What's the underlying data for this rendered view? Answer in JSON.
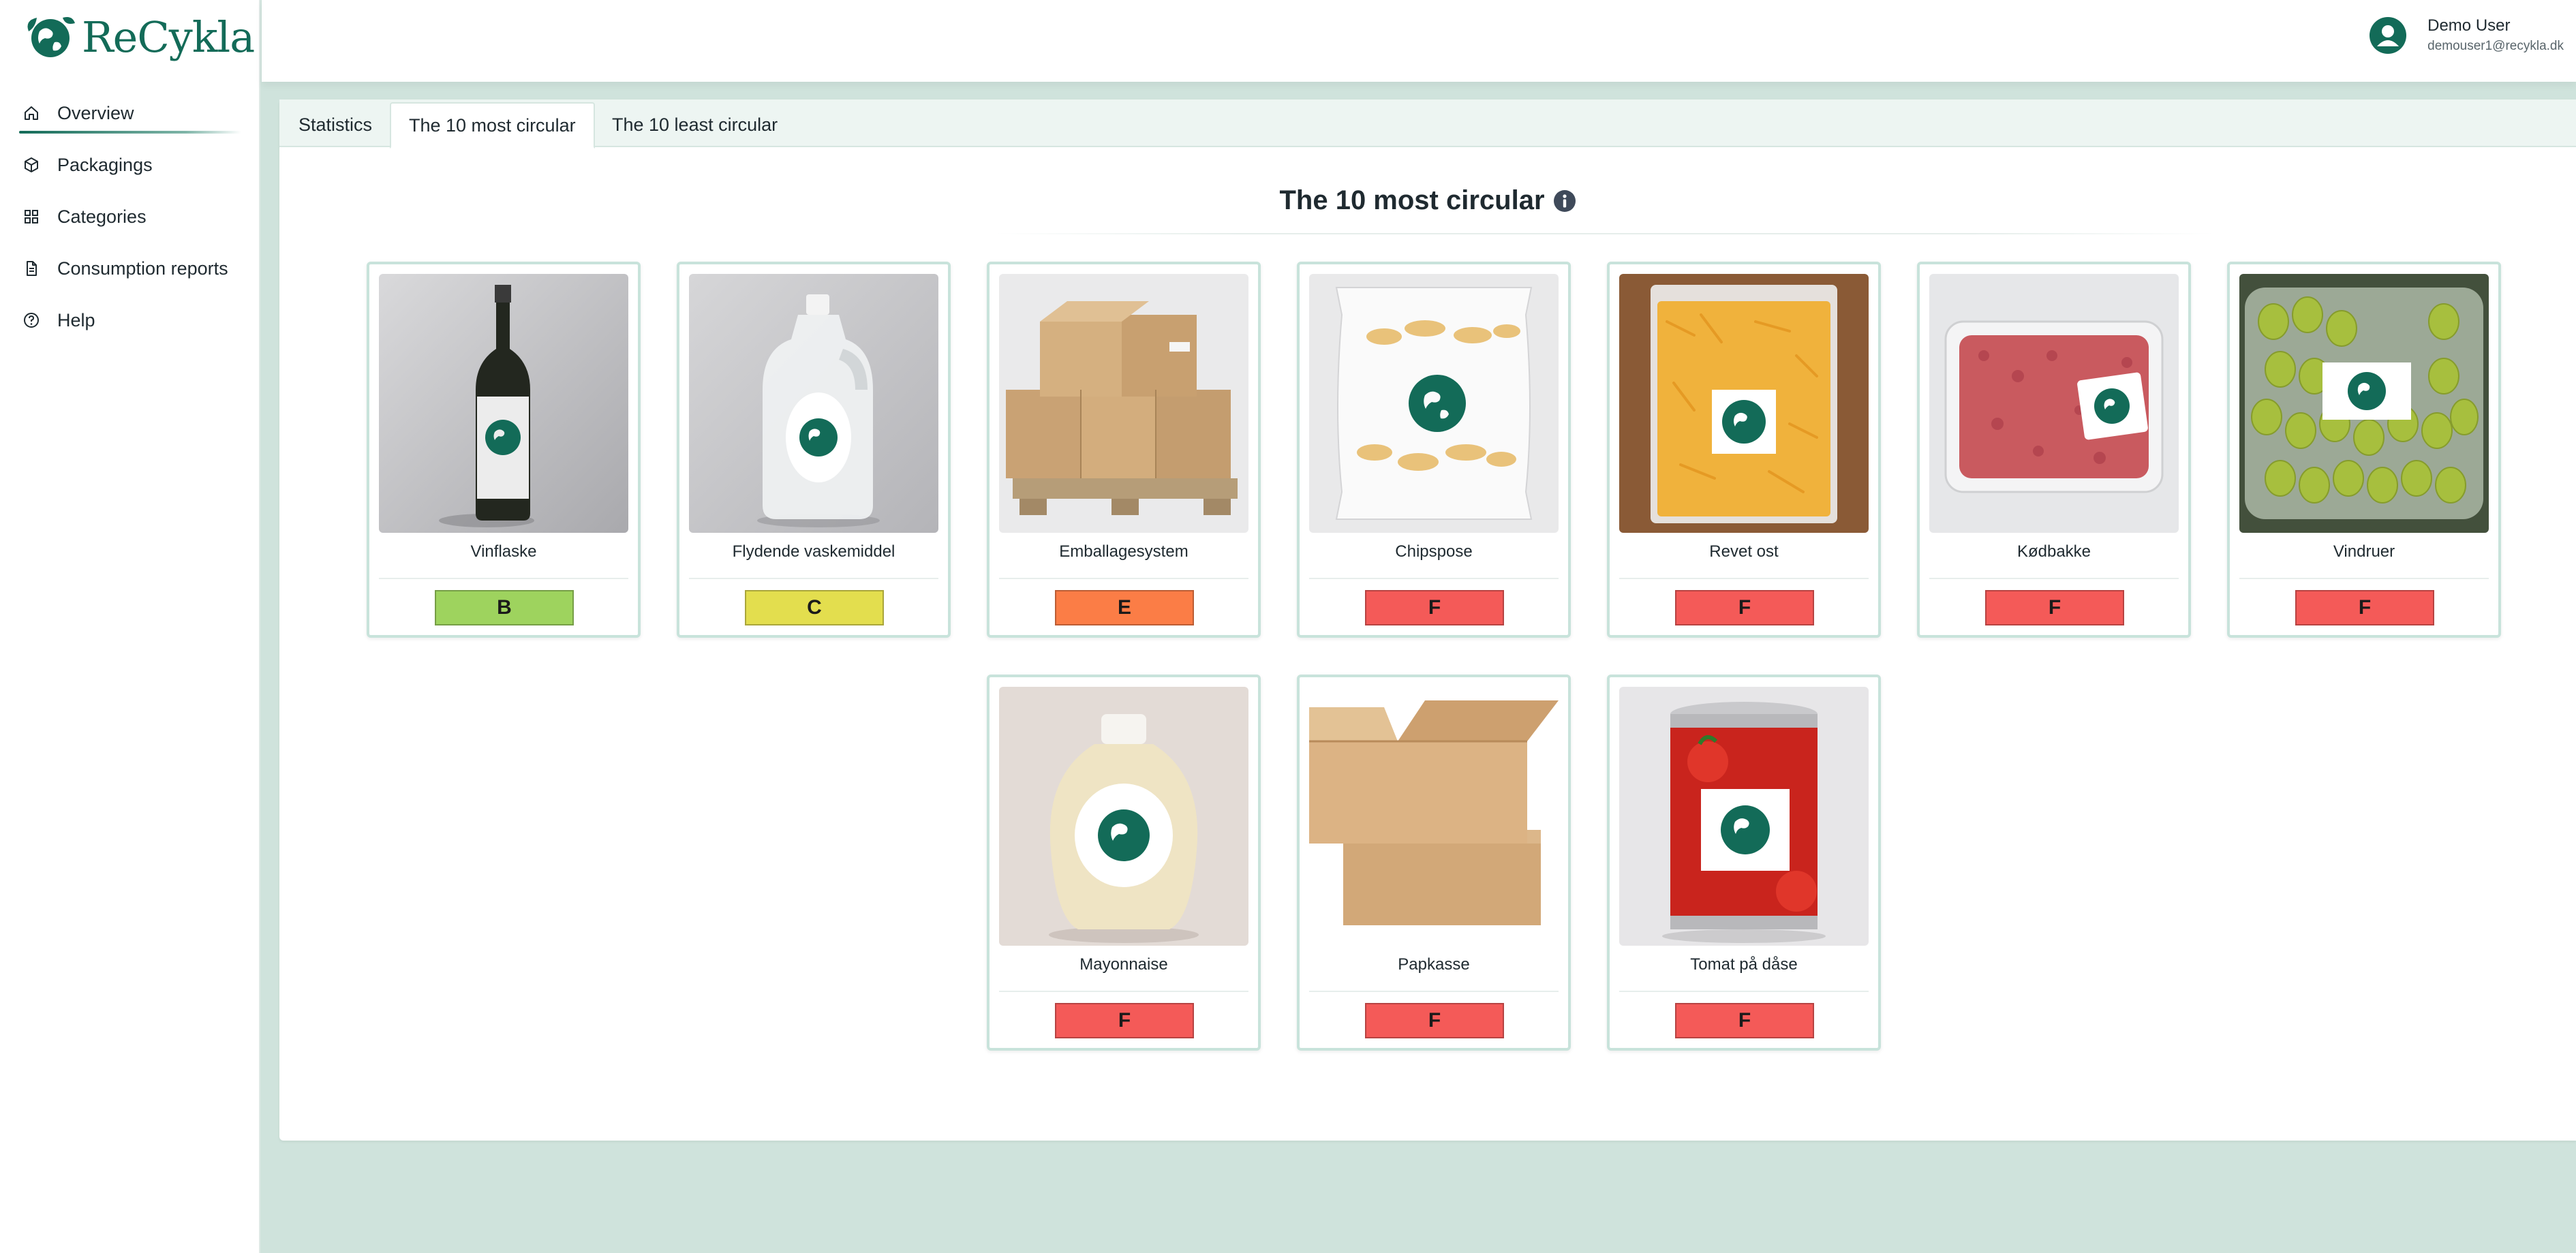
{
  "app": {
    "name": "ReCykla"
  },
  "sidebar": {
    "items": [
      {
        "label": "Overview",
        "icon": "home-icon",
        "active": true
      },
      {
        "label": "Packagings",
        "icon": "box-icon",
        "active": false
      },
      {
        "label": "Categories",
        "icon": "grid-icon",
        "active": false
      },
      {
        "label": "Consumption reports",
        "icon": "document-icon",
        "active": false
      },
      {
        "label": "Help",
        "icon": "help-icon",
        "active": false
      }
    ]
  },
  "header": {
    "user": {
      "name": "Demo User",
      "email": "demouser1@recykla.dk"
    }
  },
  "tabs": [
    {
      "label": "Statistics",
      "active": false
    },
    {
      "label": "The 10 most circular",
      "active": true
    },
    {
      "label": "The 10 least circular",
      "active": false
    }
  ],
  "main": {
    "title": "The 10 most circular",
    "products": [
      {
        "name": "Vinflaske",
        "grade": "B",
        "image": "wine-bottle"
      },
      {
        "name": "Flydende vaskemiddel",
        "grade": "C",
        "image": "detergent-bottle"
      },
      {
        "name": "Emballagesystem",
        "grade": "E",
        "image": "pallet-boxes"
      },
      {
        "name": "Chipspose",
        "grade": "F",
        "image": "chips-bag"
      },
      {
        "name": "Revet ost",
        "grade": "F",
        "image": "grated-cheese"
      },
      {
        "name": "Kødbakke",
        "grade": "F",
        "image": "meat-tray"
      },
      {
        "name": "Vindruer",
        "grade": "F",
        "image": "grapes"
      },
      {
        "name": "Mayonnaise",
        "grade": "F",
        "image": "mayonnaise-bottle"
      },
      {
        "name": "Papkasse",
        "grade": "F",
        "image": "cardboard-boxes"
      },
      {
        "name": "Tomat på dåse",
        "grade": "F",
        "image": "tomato-can"
      }
    ]
  },
  "colors": {
    "brand": "#136b58",
    "grade_B": "#9ed35e",
    "grade_C": "#e3de4e",
    "grade_E": "#fb7d46",
    "grade_F": "#f45a58"
  }
}
